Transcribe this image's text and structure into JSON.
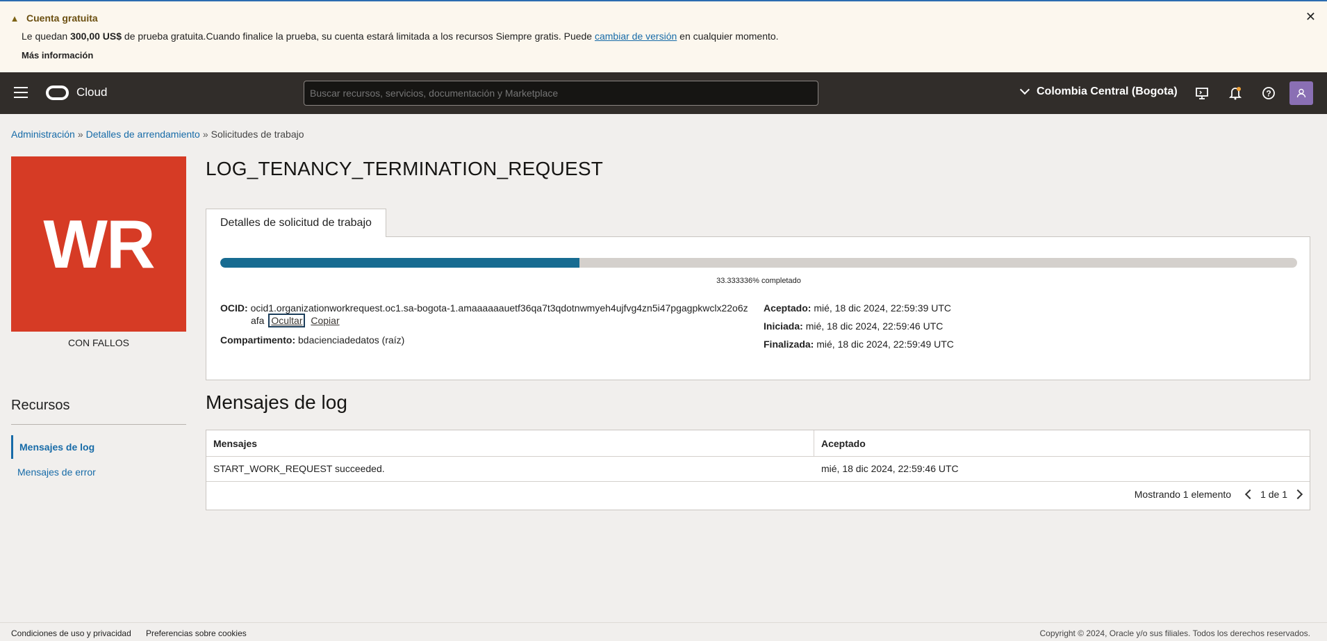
{
  "banner": {
    "title": "Cuenta gratuita",
    "text_prefix": "Le quedan ",
    "text_amount": "300,00 US$",
    "text_middle": " de prueba gratuita.Cuando finalice la prueba, su cuenta estará limitada a los recursos Siempre gratis. Puede ",
    "text_link": "cambiar de versión",
    "text_suffix": " en cualquier momento.",
    "more_link": "Más información",
    "icon": "warning-icon"
  },
  "header": {
    "brand": "Cloud",
    "search_placeholder": "Buscar recursos, servicios, documentación y Marketplace",
    "region": "Colombia Central (Bogota)"
  },
  "breadcrumb": {
    "items": [
      "Administración",
      "Detalles de arrendamiento",
      "Solicitudes de trabajo"
    ],
    "separator": "»"
  },
  "resource": {
    "initials": "WR",
    "status": "CON FALLOS",
    "badge_color": "#d63b25"
  },
  "resources_nav": {
    "title": "Recursos",
    "items": [
      "Mensajes de log",
      "Mensajes de error"
    ]
  },
  "page": {
    "title": "LOG_TENANCY_TERMINATION_REQUEST",
    "tab": "Detalles de solicitud de trabajo",
    "progress_percent": 33.333336,
    "progress_label": "33.333336% completado"
  },
  "details": {
    "ocid_label": "OCID:",
    "ocid_line1": "ocid1.organizationworkrequest.oc1.sa-bogota-1.amaaaaaauetf36qa7t3qdotnwmyeh4ujfvg4zn5i47pgagpkwclx22o6z",
    "ocid_line2": "afa",
    "hide_link": "Ocultar",
    "copy_link": "Copiar",
    "compartment_label": "Compartimento:",
    "compartment_value": "bdacienciadedatos (raíz)",
    "accepted_label": "Aceptado:",
    "accepted_value": "mié, 18 dic 2024, 22:59:39 UTC",
    "started_label": "Iniciada:",
    "started_value": "mié, 18 dic 2024, 22:59:46 UTC",
    "finished_label": "Finalizada:",
    "finished_value": "mié, 18 dic 2024, 22:59:49 UTC"
  },
  "log": {
    "title": "Mensajes de log",
    "columns": [
      "Mensajes",
      "Aceptado"
    ],
    "rows": [
      [
        "START_WORK_REQUEST succeeded.",
        "mié, 18 dic 2024, 22:59:46 UTC"
      ]
    ],
    "showing": "Mostrando 1 elemento",
    "page": "1 de 1"
  },
  "footer": {
    "terms": "Condiciones de uso y privacidad",
    "cookies": "Preferencias sobre cookies",
    "copyright": "Copyright © 2024, Oracle y/o sus filiales. Todos los derechos reservados."
  }
}
